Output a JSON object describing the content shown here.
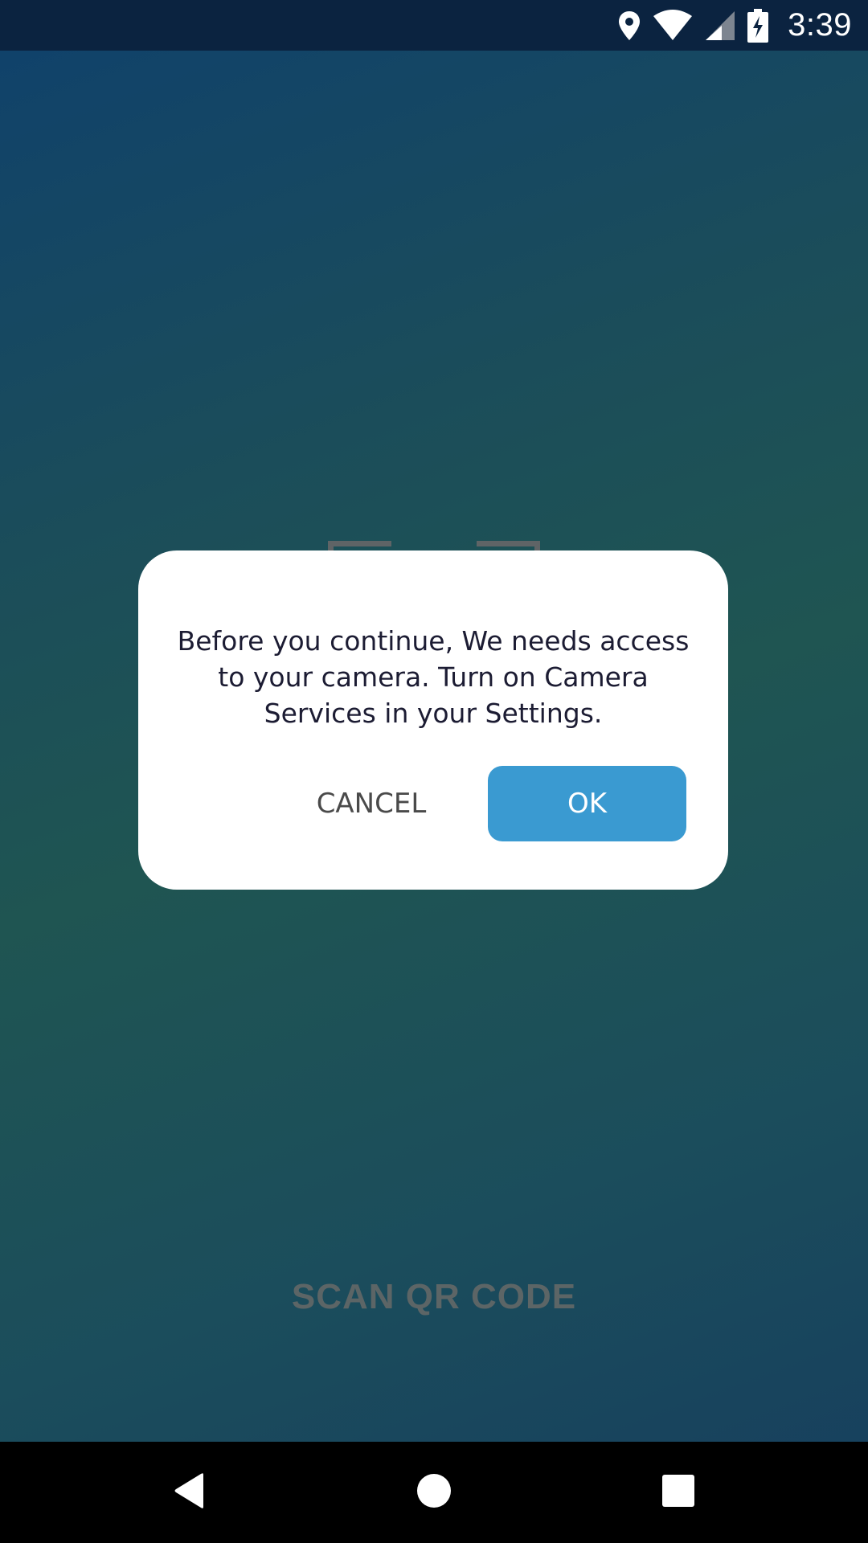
{
  "status_bar": {
    "time": "3:39",
    "icons": [
      "location-icon",
      "wifi-icon",
      "cell-signal-icon",
      "battery-charging-icon"
    ]
  },
  "background": {
    "partial_label": "",
    "scan_label": "SCAN QR CODE"
  },
  "dialog": {
    "message": "Before you continue, We needs access to your camera. Turn on Camera Services in your Settings.",
    "cancel_label": "CANCEL",
    "ok_label": "OK",
    "ok_color": "#3a9ad1"
  },
  "nav_bar": {
    "buttons": [
      "back-icon",
      "home-icon",
      "recents-icon"
    ]
  }
}
